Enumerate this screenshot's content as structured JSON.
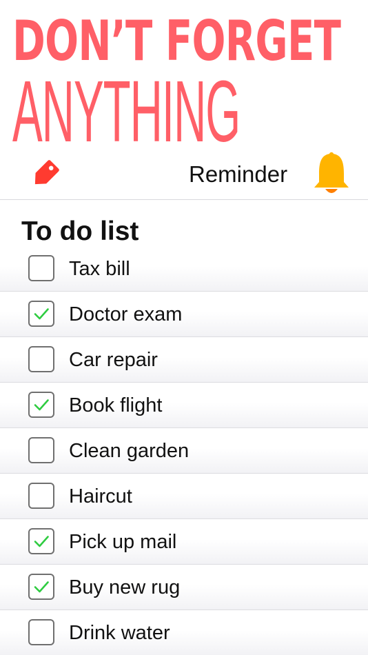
{
  "hero": {
    "line1": "DON’T FORGET",
    "line2": "ANYTHING",
    "color": "#ff5f67"
  },
  "header": {
    "tag_icon": "tag-icon",
    "reminder_label": "Reminder",
    "bell_icon": "bell-icon",
    "tag_color": "#ff3b30",
    "bell_color": "#ffb400"
  },
  "list": {
    "title": "To do list",
    "check_color": "#2ecc40",
    "items": [
      {
        "label": "Tax bill",
        "checked": false
      },
      {
        "label": "Doctor exam",
        "checked": true
      },
      {
        "label": "Car repair",
        "checked": false
      },
      {
        "label": "Book flight",
        "checked": true
      },
      {
        "label": "Clean garden",
        "checked": false
      },
      {
        "label": "Haircut",
        "checked": false
      },
      {
        "label": "Pick up mail",
        "checked": true
      },
      {
        "label": "Buy new rug",
        "checked": true
      },
      {
        "label": "Drink water",
        "checked": false
      }
    ]
  }
}
